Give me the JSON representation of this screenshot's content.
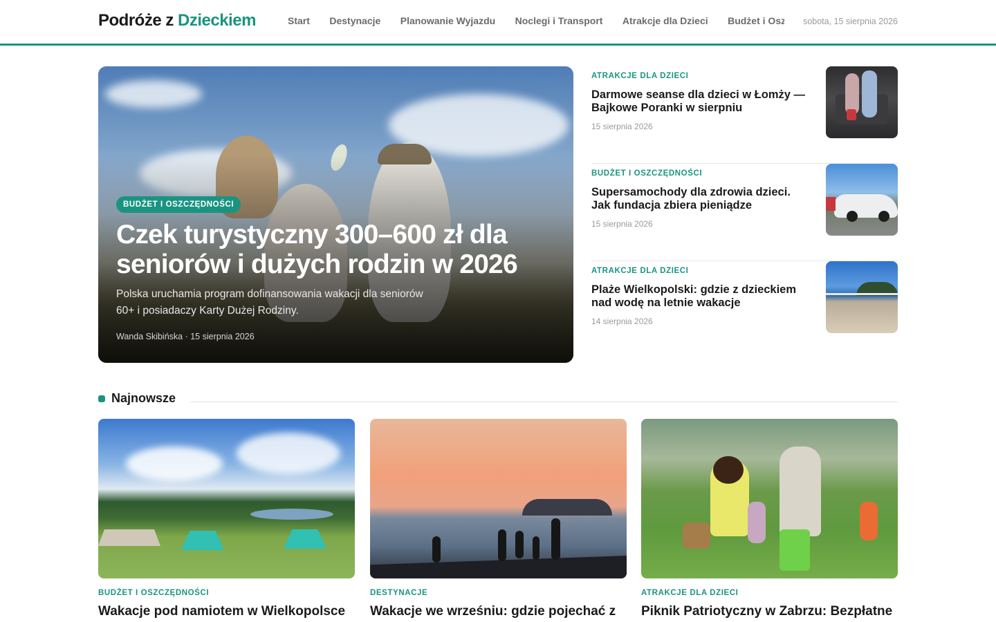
{
  "site": {
    "logo_main": "Podróże z",
    "logo_accent": "Dzieckiem",
    "date": "sobota, 15 sierpnia 2026"
  },
  "nav": {
    "items": [
      "Start",
      "Destynacje",
      "Planowanie Wyjazdu",
      "Noclegi i Transport",
      "Atrakcje dla Dzieci",
      "Budżet i Oszczędności"
    ]
  },
  "hero": {
    "category": "BUDŻET I OSZCZĘDNOŚCI",
    "title": "Czek turystyczny 300–600 zł dla seniorów i dużych rodzin w 2026",
    "lead": "Polska uruchamia program dofinansowania wakacji dla seniorów 60+ i posiadaczy Karty Dużej Rodziny.",
    "meta": "Wanda Skibińska · 15 sierpnia 2026"
  },
  "side": [
    {
      "category": "ATRAKCJE DLA DZIECI",
      "title": "Darmowe seanse dla dzieci w Łomży — Bajkowe Poranki w sierpniu",
      "date": "15 sierpnia 2026"
    },
    {
      "category": "BUDŻET I OSZCZĘDNOŚCI",
      "title": "Supersamochody dla zdrowia dzieci. Jak fundacja zbiera pieniądze",
      "date": "15 sierpnia 2026"
    },
    {
      "category": "ATRAKCJE DLA DZIECI",
      "title": "Plaże Wielkopolski: gdzie z dzieckiem nad wodę na letnie wakacje",
      "date": "14 sierpnia 2026"
    }
  ],
  "section": {
    "title": "Najnowsze"
  },
  "cards": [
    {
      "category": "BUDŻET I OSZCZĘDNOŚCI",
      "title": "Wakacje pod namiotem w Wielkopolsce"
    },
    {
      "category": "DESTYNACJE",
      "title": "Wakacje we wrześniu: gdzie pojechać z"
    },
    {
      "category": "ATRAKCJE DLA DZIECI",
      "title": "Piknik Patriotyczny w Zabrzu: Bezpłatne"
    }
  ],
  "colors": {
    "accent": "#1a9480",
    "text": "#1a1a1a",
    "muted": "#9a9a9a"
  }
}
